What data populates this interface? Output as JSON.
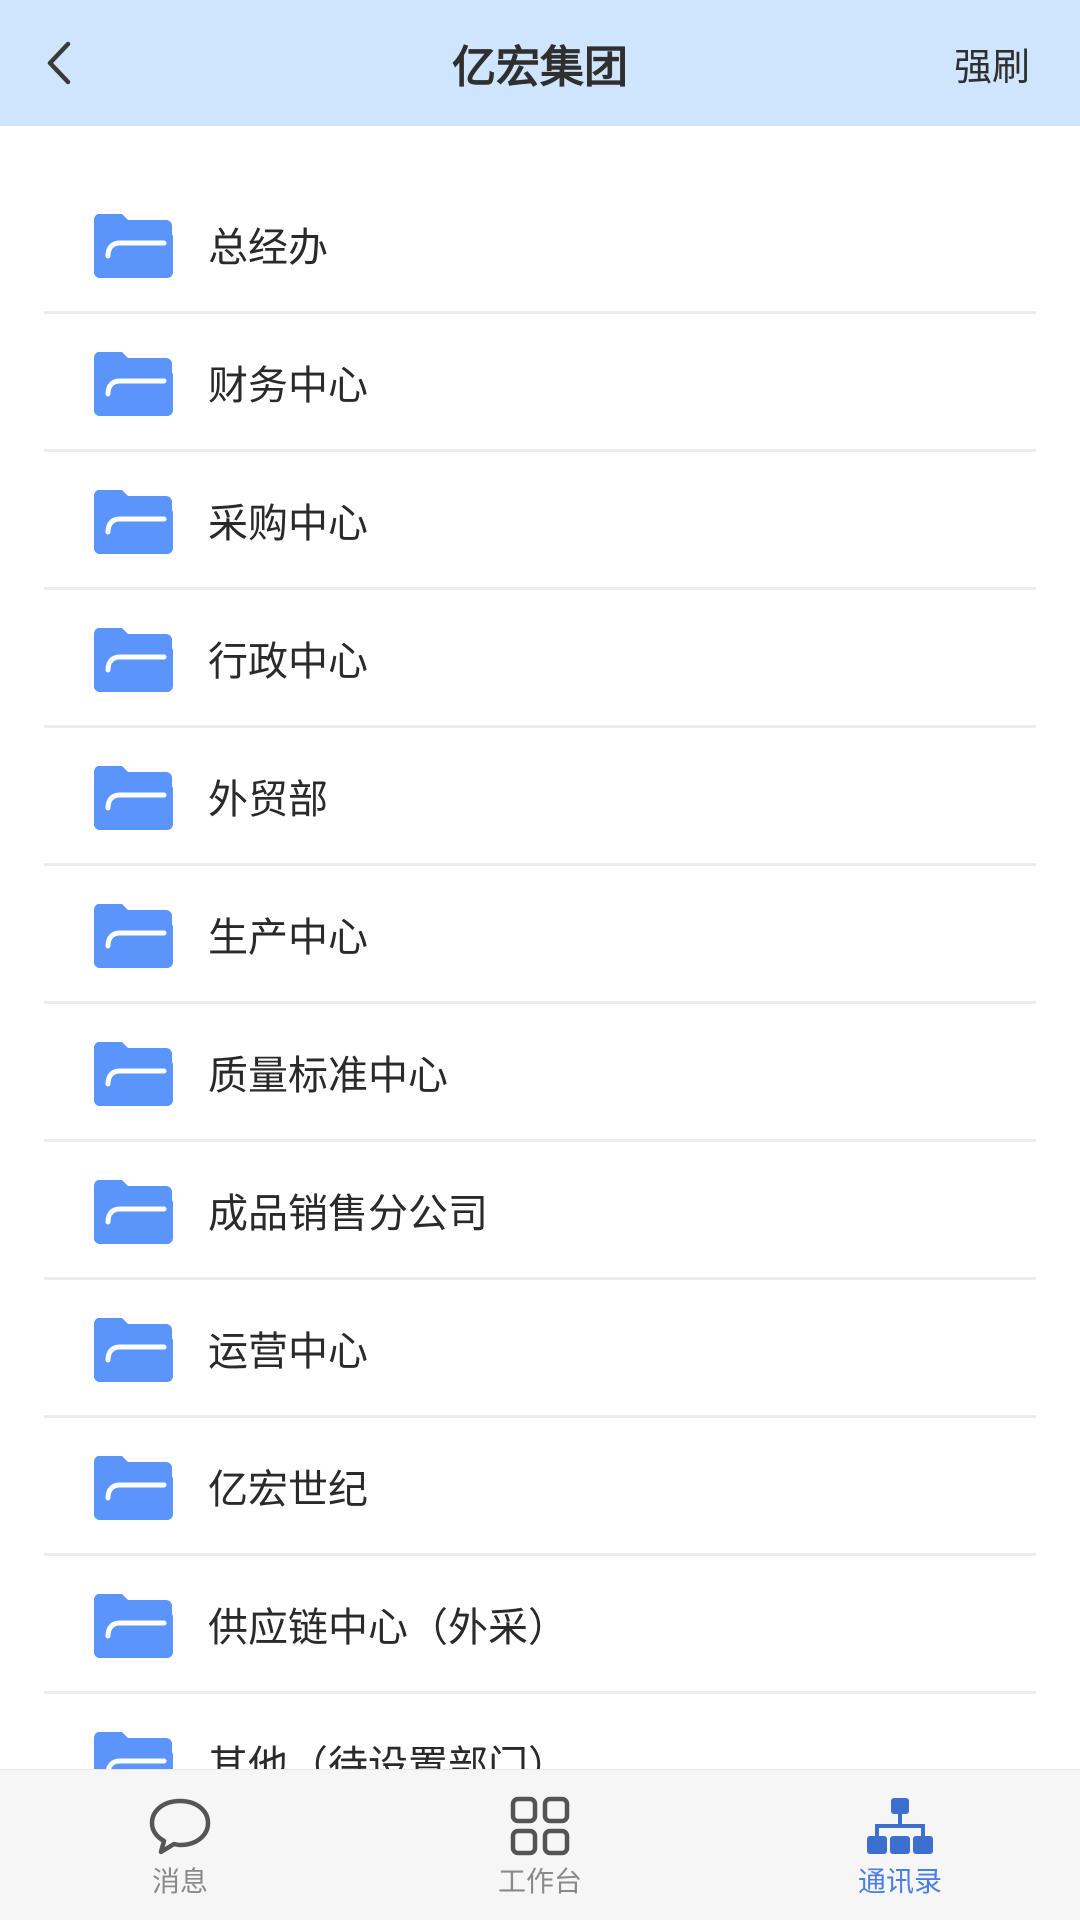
{
  "header": {
    "title": "亿宏集团",
    "back_icon": "chevron-left-icon",
    "refresh_label": "强刷"
  },
  "departments": [
    {
      "label": "总经办"
    },
    {
      "label": "财务中心"
    },
    {
      "label": "采购中心"
    },
    {
      "label": "行政中心"
    },
    {
      "label": "外贸部"
    },
    {
      "label": "生产中心"
    },
    {
      "label": "质量标准中心"
    },
    {
      "label": "成品销售分公司"
    },
    {
      "label": "运营中心"
    },
    {
      "label": "亿宏世纪"
    },
    {
      "label": "供应链中心（外采）"
    },
    {
      "label": "其他（待设置部门）"
    }
  ],
  "tabbar": {
    "tabs": [
      {
        "label": "消息",
        "icon": "chat-bubble-icon",
        "active": false
      },
      {
        "label": "工作台",
        "icon": "grid-icon",
        "active": false
      },
      {
        "label": "通讯录",
        "icon": "org-chart-icon",
        "active": true
      }
    ]
  },
  "colors": {
    "header_bg": "#cfe5fd",
    "folder": "#5b95fb",
    "active_tab": "#4a7fe6",
    "inactive_tab": "#8a8a8a"
  }
}
